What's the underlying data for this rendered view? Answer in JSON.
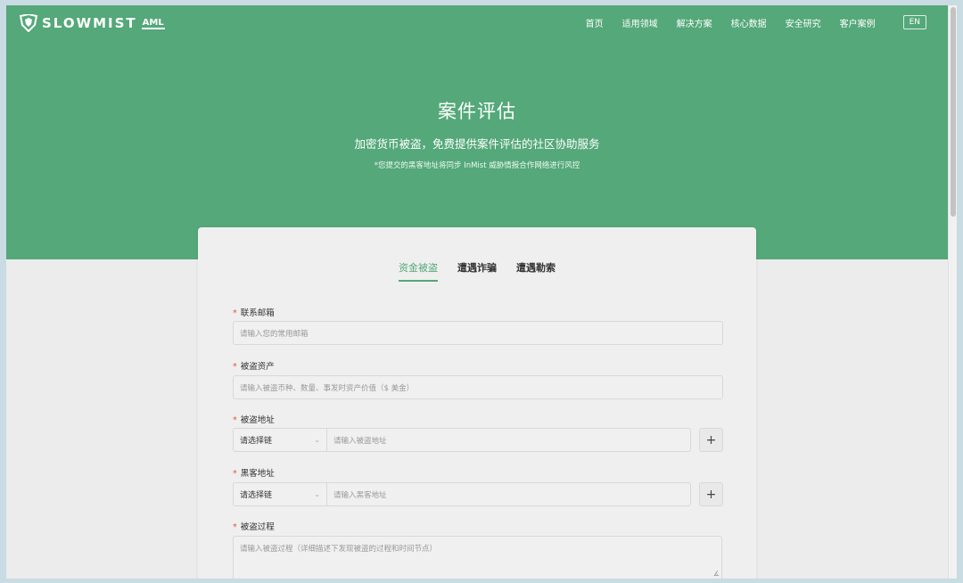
{
  "brand": {
    "logo_text": "SLOWMIST",
    "logo_badge": "AML"
  },
  "nav": {
    "items": [
      "首页",
      "适用领域",
      "解决方案",
      "核心数据",
      "安全研究",
      "客户案例"
    ],
    "lang": "EN"
  },
  "hero": {
    "title": "案件评估",
    "subtitle": "加密货币被盗，免费提供案件评估的社区协助服务",
    "note": "*您提交的黑客地址将同步 InMist 威胁情报合作网络进行风控"
  },
  "tabs": [
    {
      "label": "资金被盗",
      "active": true
    },
    {
      "label": "遭遇诈骗",
      "active": false
    },
    {
      "label": "遭遇勒索",
      "active": false
    }
  ],
  "form": {
    "required_mark": "*",
    "email": {
      "label": "联系邮箱",
      "placeholder": "请输入您的常用邮箱"
    },
    "assets": {
      "label": "被盗资产",
      "placeholder": "请输入被盗币种、数量、事发时资产价值（$ 美金）"
    },
    "stolen_address": {
      "label": "被盗地址",
      "chain_select": "请选择链",
      "placeholder": "请输入被盗地址",
      "add_label": "+"
    },
    "hacker_address": {
      "label": "黑客地址",
      "chain_select": "请选择链",
      "placeholder": "请输入黑客地址",
      "add_label": "+"
    },
    "process": {
      "label": "被盗过程",
      "placeholder": "请输入被盗过程（详细描述下发现被盗的过程和时间节点）"
    }
  },
  "colors": {
    "brand_green": "#54a879",
    "required_red": "#e0533f"
  },
  "icons": [
    "logo-mark-icon",
    "chevron-down-icon",
    "plus-icon",
    "resize-handle-icon"
  ]
}
